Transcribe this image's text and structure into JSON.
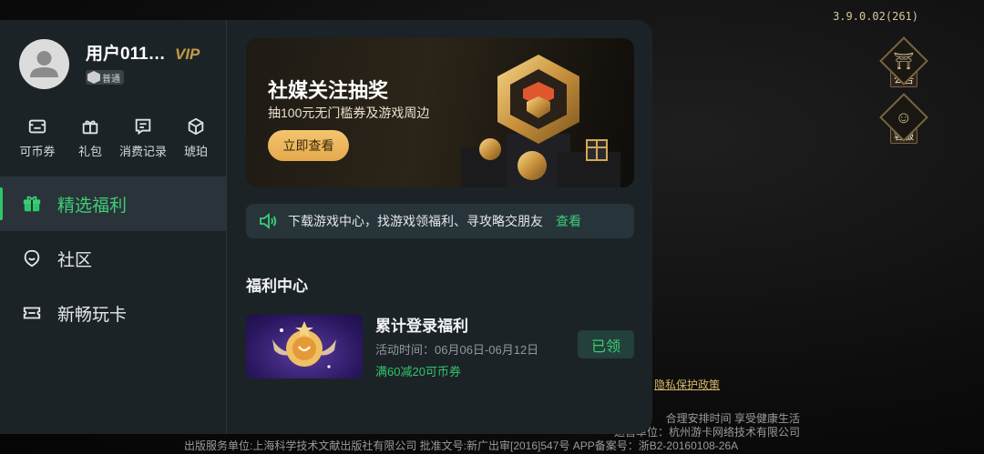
{
  "version": "3.9.0.02(261)",
  "side_buttons": [
    {
      "label": "公告",
      "icon": "notice-gate-icon"
    },
    {
      "label": "客服",
      "icon": "customer-service-icon"
    }
  ],
  "privacy_link": "隐私保护政策",
  "footer": {
    "line1": "合理安排时间 享受健康生活",
    "line2": "运营单位：杭州游卡网络技术有限公司",
    "line3": "出版服务单位:上海科学技术文献出版社有限公司 批准文号:新广出审[2016]547号 APP备案号：浙B2-20160108-26A"
  },
  "user": {
    "name": "用户011…",
    "vip": "VIP",
    "level": "普通"
  },
  "quick_actions": [
    {
      "label": "可币券",
      "icon": "coupon-icon"
    },
    {
      "label": "礼包",
      "icon": "gift-icon"
    },
    {
      "label": "消费记录",
      "icon": "record-icon"
    },
    {
      "label": "琥珀",
      "icon": "amber-icon"
    }
  ],
  "nav": [
    {
      "label": "精选福利",
      "icon": "gift-box-icon",
      "active": true
    },
    {
      "label": "社区",
      "icon": "community-icon",
      "active": false
    },
    {
      "label": "新畅玩卡",
      "icon": "play-card-icon",
      "active": false
    }
  ],
  "banner": {
    "title": "社媒关注抽奖",
    "subtitle": "抽100元无门槛券及游戏周边",
    "button": "立即查看"
  },
  "notice": {
    "text": "下载游戏中心，找游戏领福利、寻攻略交朋友",
    "action": "查看"
  },
  "welfare": {
    "section_title": "福利中心",
    "item": {
      "title": "累计登录福利",
      "time": "活动时间：06月06日-06月12日",
      "coupon": "满60减20可币券",
      "button": "已领"
    }
  },
  "colors": {
    "accent_green": "#3ccd77",
    "vip_gold": "#c49a45",
    "panel_bg": "#1c2327"
  }
}
